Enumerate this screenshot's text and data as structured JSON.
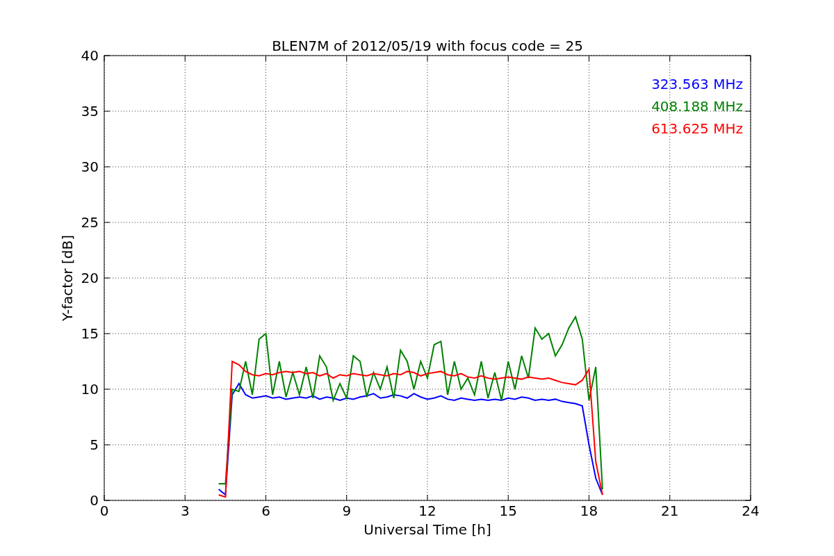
{
  "figure": {
    "chart_data": {
      "type": "line",
      "title": "BLEN7M of 2012/05/19 with focus code = 25",
      "xlabel": "Universal Time [h]",
      "ylabel": "Y-factor [dB]",
      "xlim": [
        0,
        24
      ],
      "ylim": [
        0,
        40
      ],
      "grid": true,
      "xticks": [
        0,
        3,
        6,
        9,
        12,
        15,
        18,
        21,
        24
      ],
      "yticks": [
        0,
        5,
        10,
        15,
        20,
        25,
        30,
        35,
        40
      ],
      "x": [
        4.25,
        4.5,
        4.75,
        5,
        5.25,
        5.5,
        5.75,
        6,
        6.25,
        6.5,
        6.75,
        7,
        7.25,
        7.5,
        7.75,
        8,
        8.25,
        8.5,
        8.75,
        9,
        9.25,
        9.5,
        9.75,
        10,
        10.25,
        10.5,
        10.75,
        11,
        11.25,
        11.5,
        11.75,
        12,
        12.25,
        12.5,
        12.75,
        13,
        13.25,
        13.5,
        13.75,
        14,
        14.25,
        14.5,
        14.75,
        15,
        15.25,
        15.5,
        15.75,
        16,
        16.25,
        16.5,
        16.75,
        17,
        17.25,
        17.5,
        17.75,
        18,
        18.25,
        18.5
      ],
      "series": [
        {
          "name": "323.563 MHz",
          "color": "#0000ff",
          "values": [
            1,
            0.5,
            9.5,
            10.5,
            9.5,
            9.2,
            9.3,
            9.4,
            9.2,
            9.3,
            9.1,
            9.2,
            9.3,
            9.2,
            9.4,
            9.1,
            9.3,
            9.2,
            9.0,
            9.2,
            9.1,
            9.3,
            9.4,
            9.6,
            9.2,
            9.3,
            9.5,
            9.4,
            9.2,
            9.6,
            9.3,
            9.1,
            9.2,
            9.4,
            9.1,
            9.0,
            9.2,
            9.1,
            9.0,
            9.1,
            9.0,
            9.1,
            9.0,
            9.2,
            9.1,
            9.3,
            9.2,
            9.0,
            9.1,
            9.0,
            9.1,
            8.9,
            8.8,
            8.7,
            8.5,
            5,
            2,
            0.5
          ]
        },
        {
          "name": "408.188 MHz",
          "color": "#008000",
          "values": [
            1.5,
            1.5,
            10,
            9.8,
            12.5,
            9.5,
            14.5,
            15,
            9.5,
            12.5,
            9.3,
            11.5,
            9.5,
            12,
            9.2,
            13,
            12,
            9.0,
            10.5,
            9.2,
            13,
            12.5,
            9.3,
            11.5,
            10,
            12,
            9.2,
            13.5,
            12.5,
            10,
            12.5,
            11,
            14,
            14.3,
            9.5,
            12.5,
            10,
            11,
            9.5,
            12.5,
            9.2,
            11.5,
            9,
            12.5,
            10,
            13,
            11,
            15.5,
            14.5,
            15,
            13,
            14,
            15.5,
            16.5,
            14.5,
            9,
            12,
            1
          ]
        },
        {
          "name": "613.625 MHz",
          "color": "#ff0000",
          "values": [
            0.5,
            0.3,
            12.5,
            12.2,
            11.6,
            11.3,
            11.2,
            11.4,
            11.3,
            11.5,
            11.6,
            11.5,
            11.6,
            11.4,
            11.5,
            11.2,
            11.4,
            11.0,
            11.3,
            11.2,
            11.4,
            11.3,
            11.2,
            11.4,
            11.3,
            11.2,
            11.4,
            11.3,
            11.6,
            11.5,
            11.2,
            11.4,
            11.5,
            11.6,
            11.3,
            11.2,
            11.4,
            11.1,
            11.0,
            11.2,
            11.0,
            10.9,
            11.0,
            11.1,
            11.0,
            10.9,
            11.1,
            11.0,
            10.9,
            11.0,
            10.8,
            10.6,
            10.5,
            10.4,
            10.8,
            11.8,
            3.5,
            0.5
          ]
        }
      ]
    }
  }
}
